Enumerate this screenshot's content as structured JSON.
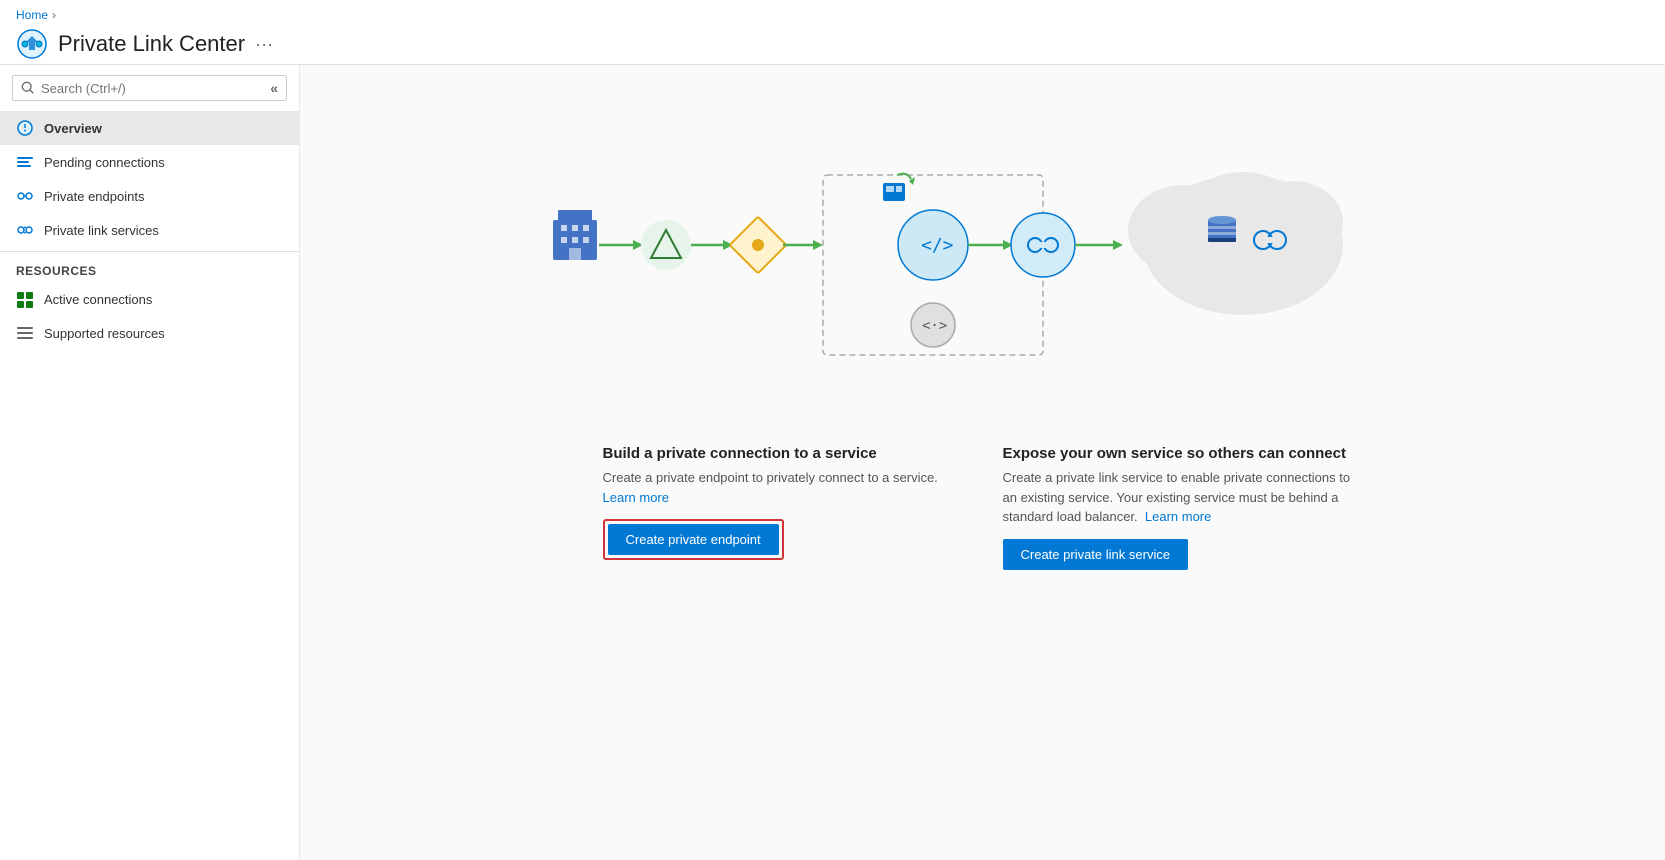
{
  "header": {
    "breadcrumb_home": "Home",
    "title": "Private Link Center",
    "more_icon": "···"
  },
  "search": {
    "placeholder": "Search (Ctrl+/)"
  },
  "nav": {
    "overview_label": "Overview",
    "pending_connections_label": "Pending connections",
    "private_endpoints_label": "Private endpoints",
    "private_link_services_label": "Private link services",
    "resources_section_label": "Resources",
    "active_connections_label": "Active connections",
    "supported_resources_label": "Supported resources"
  },
  "cards": {
    "card1": {
      "title": "Build a private connection to a service",
      "description": "Create a private endpoint to privately connect to a service.",
      "learn_more": "Learn more",
      "button_label": "Create private endpoint"
    },
    "card2": {
      "title": "Expose your own service so others can connect",
      "description": "Create a private link service to enable private connections to an existing service. Your existing service must be behind a standard load balancer.",
      "learn_more": "Learn more",
      "button_label": "Create private link service"
    }
  },
  "colors": {
    "accent": "#0078d4",
    "green_arrow": "#4caf50",
    "highlight_border": "#d13438",
    "node_bg": "#d1ecf8",
    "dashed_border": "#aaa",
    "cloud_bg": "#e8e8e8"
  }
}
